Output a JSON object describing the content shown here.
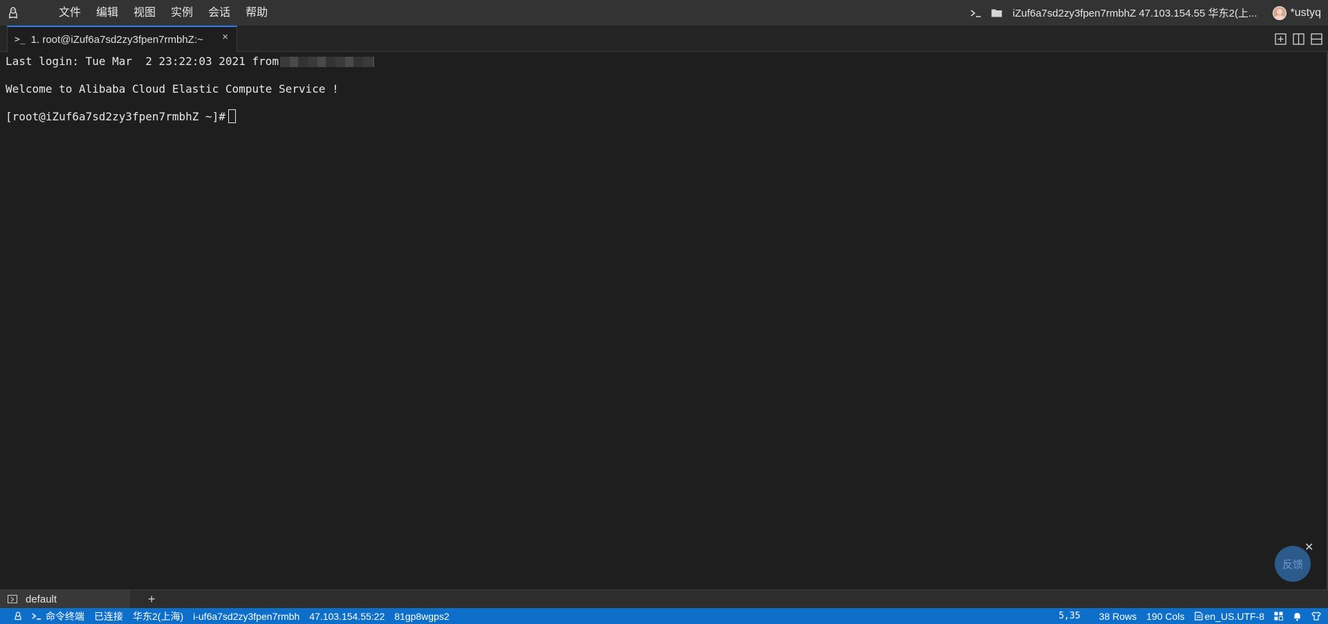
{
  "menubar": {
    "items": [
      "文件",
      "编辑",
      "视图",
      "实例",
      "会话",
      "帮助"
    ],
    "connection": "iZuf6a7sd2zy3fpen7rmbhZ 47.103.154.55 华东2(上...",
    "user": "*ustyq"
  },
  "tabs": [
    {
      "label": "1. root@iZuf6a7sd2zy3fpen7rmbhZ:~",
      "prompt": ">_",
      "close": "×"
    }
  ],
  "terminal": {
    "line1": "Last login: Tue Mar  2 23:22:03 2021 from",
    "line2": "Welcome to Alibaba Cloud Elastic Compute Service !",
    "prompt": "[root@iZuf6a7sd2zy3fpen7rmbhZ ~]#"
  },
  "feedback": {
    "label": "反馈",
    "close": "✕"
  },
  "session": {
    "name": "default",
    "add": "+"
  },
  "statusbar": {
    "terminal_type": "命令终端",
    "connection_status": "已连接",
    "region": "华东2(上海)",
    "instance_id": "i-uf6a7sd2zy3fpen7rmbh",
    "address": "47.103.154.55:22",
    "session_id": "81gp8wgps2",
    "cursor_pos": "5,35",
    "rows": "38 Rows",
    "cols": "190 Cols",
    "encoding": "en_US.UTF-8"
  },
  "colors": {
    "accent": "#0d6fc9",
    "background": "#1e1e1e",
    "menubar": "#333333"
  }
}
